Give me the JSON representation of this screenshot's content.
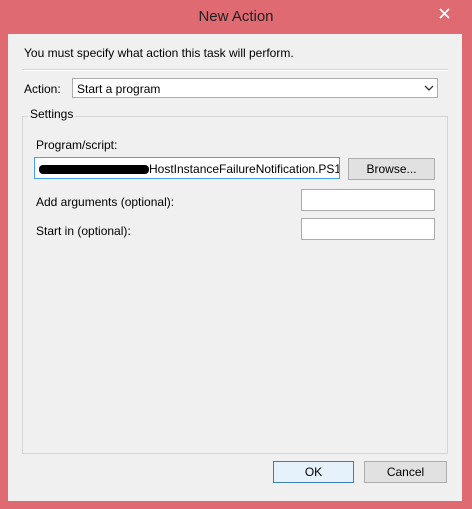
{
  "window": {
    "title": "New Action",
    "close_icon": "close-icon",
    "frame_color": "#e06a72"
  },
  "dialog": {
    "description": "You must specify what action this task will perform.",
    "action_label": "Action:",
    "action_value": "Start a program",
    "settings_title": "Settings",
    "program_label": "Program/script:",
    "program_value": "HostInstanceFailureNotification.PS1",
    "browse_label": "Browse...",
    "arguments_label": "Add arguments (optional):",
    "arguments_value": "",
    "start_in_label": "Start in (optional):",
    "start_in_value": "",
    "ok_label": "OK",
    "cancel_label": "Cancel"
  }
}
